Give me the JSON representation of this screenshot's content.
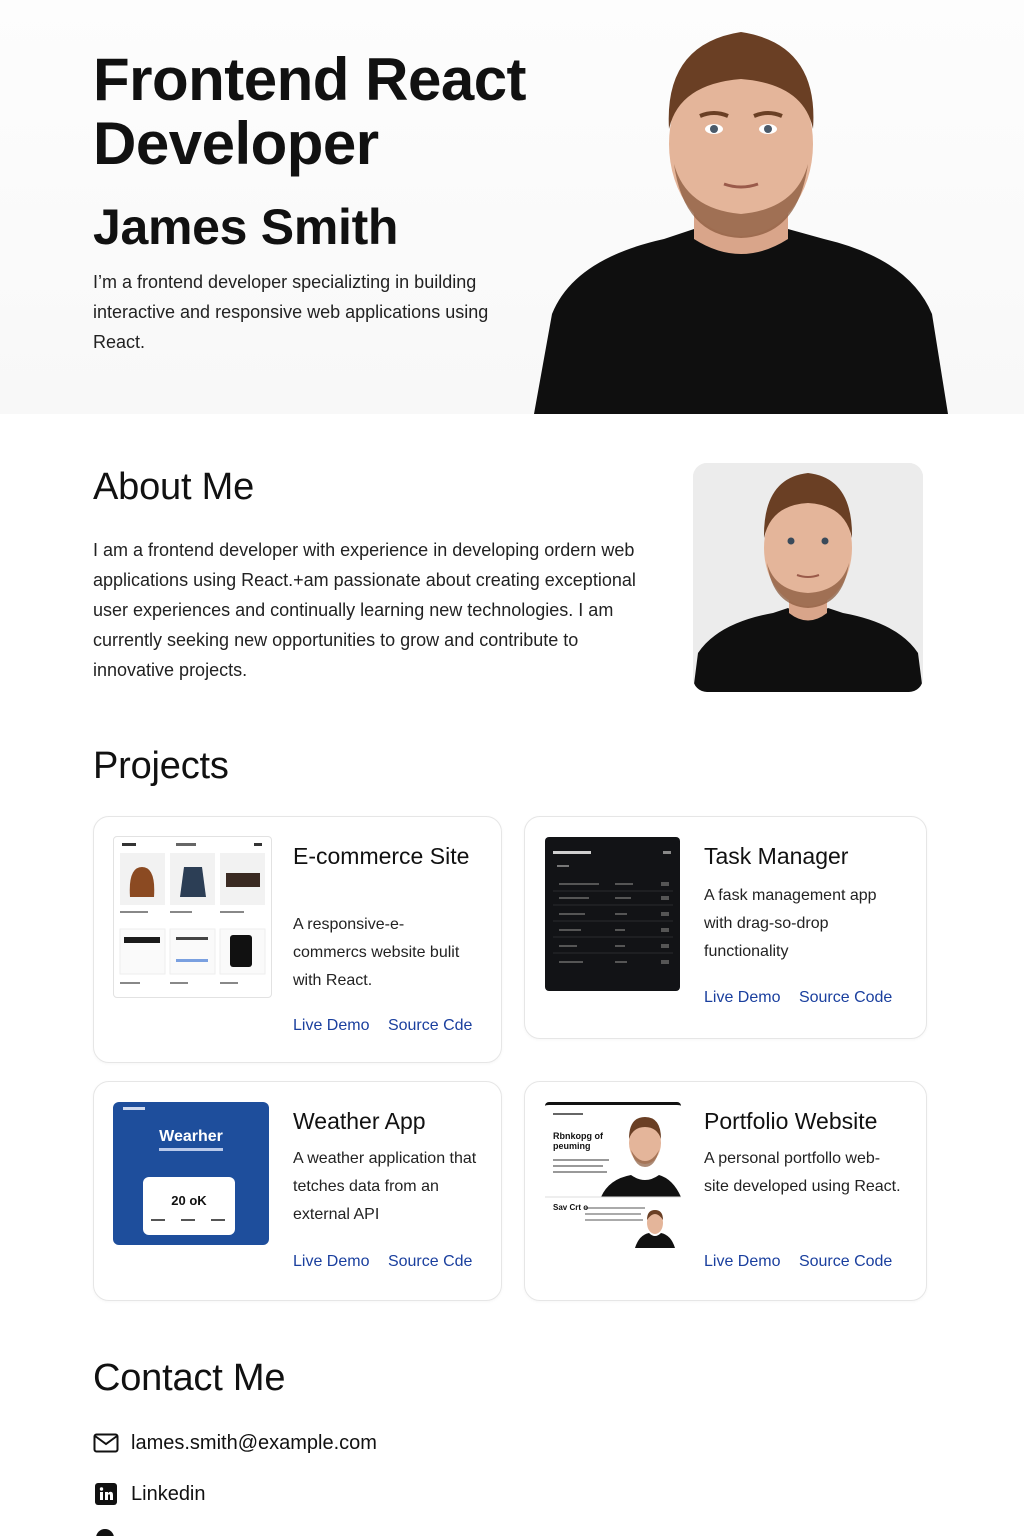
{
  "hero": {
    "title": "Frontend React Developer",
    "name": "James Smith",
    "description": "I’m a frontend developer specializting in building interactive and responsive web applications using React."
  },
  "about": {
    "title": "About Me",
    "text": "I am a frontend developer with experience in developing ordern web applications using React.+am passionate about creating exceptional user experiences and continually learning new technologies. I am currently seeking new opportunities to grow and contribute to innovative projects."
  },
  "projects": {
    "title": "Projects",
    "items": [
      {
        "title": "E-commerce Site",
        "description": "A responsive-e-commercs website bulit with React.",
        "live_label": "Live Demo",
        "source_label": "Source Cde"
      },
      {
        "title": "Task Manager",
        "description": "A fask management app with drag-so-drop functionality",
        "live_label": "Live Demo",
        "source_label": "Source Code"
      },
      {
        "title": "Weather App",
        "description": "A weather application that tetches data from an external API",
        "live_label": "Live Demo",
        "source_label": "Source Cde",
        "thumb_title": "Wearher",
        "thumb_temp": "20 oK"
      },
      {
        "title": "Portfolio Website",
        "description": "A personal portfollo web-site developed using React.",
        "live_label": "Live Demo",
        "source_label": "Source Code",
        "thumb_heading": "Rbnkopg of peuming",
        "thumb_sub": "Sav Crt o"
      }
    ]
  },
  "contact": {
    "title": "Contact Me",
    "email": "lames.smith@example.com",
    "linkedin": "Linkedin"
  },
  "colors": {
    "link": "#1a3f9e",
    "text": "#111111",
    "weather_bg": "#1e4e9c",
    "task_bg": "#121316"
  }
}
